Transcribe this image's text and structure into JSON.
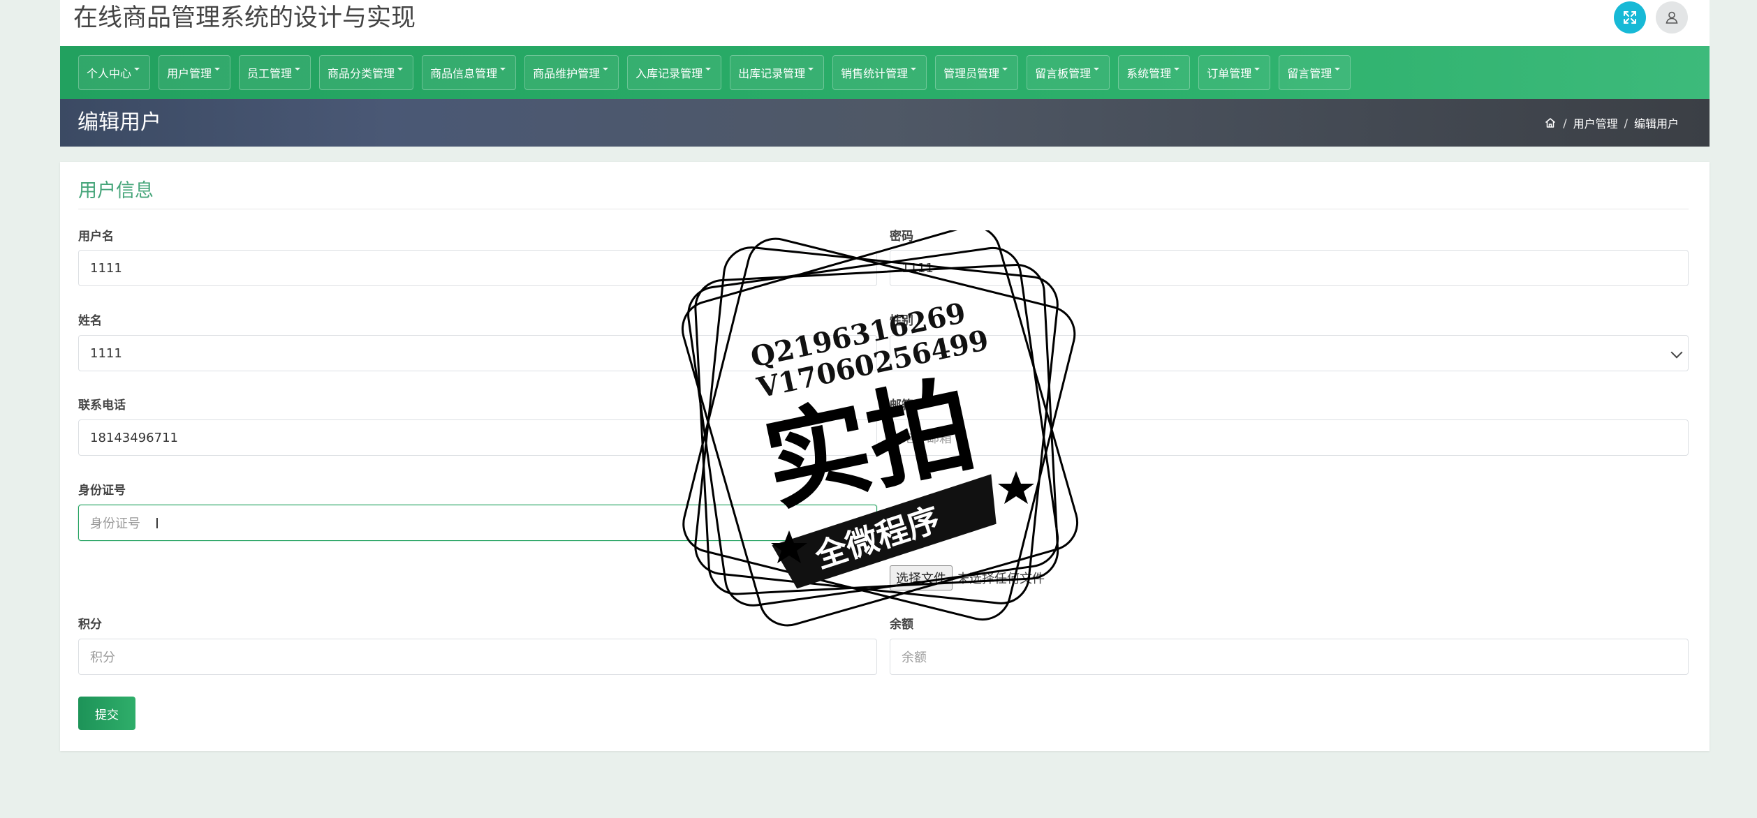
{
  "app": {
    "title": "在线商品管理系统的设计与实现"
  },
  "nav": {
    "items": [
      {
        "label": "个人中心"
      },
      {
        "label": "用户管理"
      },
      {
        "label": "员工管理"
      },
      {
        "label": "商品分类管理"
      },
      {
        "label": "商品信息管理"
      },
      {
        "label": "商品维护管理"
      },
      {
        "label": "入库记录管理"
      },
      {
        "label": "出库记录管理"
      },
      {
        "label": "销售统计管理"
      },
      {
        "label": "管理员管理"
      },
      {
        "label": "留言板管理"
      },
      {
        "label": "系统管理"
      },
      {
        "label": "订单管理"
      },
      {
        "label": "留言管理"
      }
    ]
  },
  "header": {
    "page_title": "编辑用户",
    "breadcrumb": [
      "用户管理",
      "编辑用户"
    ],
    "breadcrumb_sep": "/"
  },
  "form": {
    "section_title": "用户信息",
    "username": {
      "label": "用户名",
      "value": "1111"
    },
    "password": {
      "label": "密码",
      "value": "1111"
    },
    "name": {
      "label": "姓名",
      "value": "1111"
    },
    "gender": {
      "label": "性别",
      "value": ""
    },
    "phone": {
      "label": "联系电话",
      "value": "18143496711"
    },
    "email": {
      "label": "邮箱",
      "placeholder": "电子邮箱"
    },
    "id_card": {
      "label": "身份证号",
      "placeholder": "身份证号"
    },
    "avatar": {
      "file_button": "选择文件",
      "file_status": "未选择任何文件"
    },
    "points": {
      "label": "积分",
      "placeholder": "积分"
    },
    "balance": {
      "label": "余额",
      "placeholder": "余额"
    },
    "submit_label": "提交"
  },
  "watermark": {
    "line1": "Q2196316269",
    "line2": "V17060256499",
    "main": "实拍",
    "banner": "全微程序"
  },
  "colors": {
    "primary": "#22a15f",
    "accent_cyan": "#17b9d6",
    "section_title": "#46a57a"
  }
}
